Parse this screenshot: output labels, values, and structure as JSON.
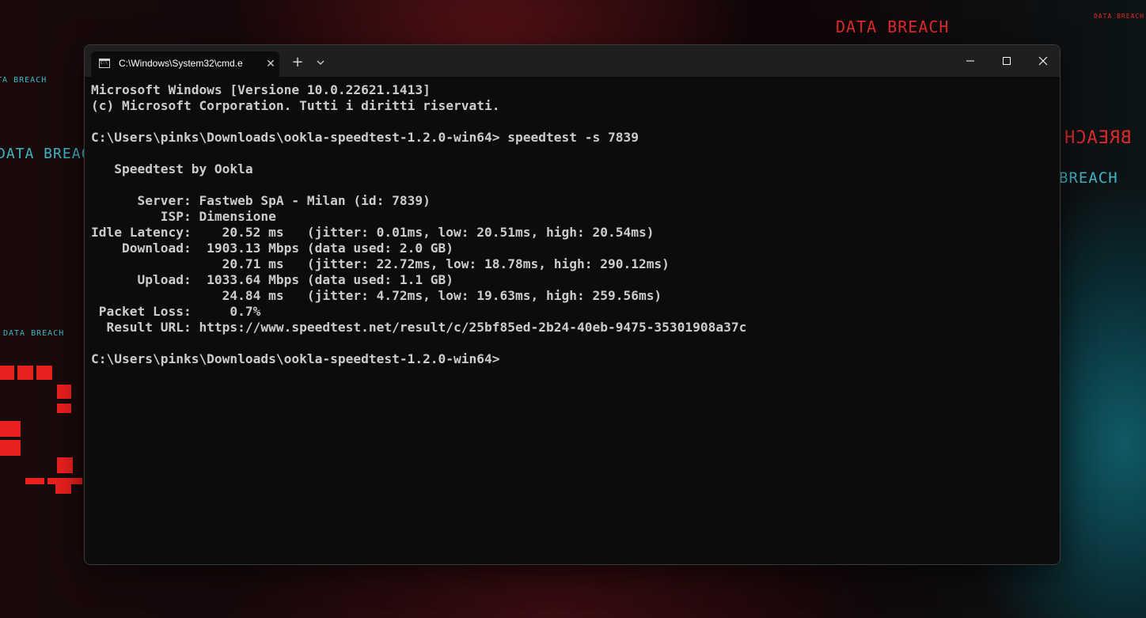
{
  "wallpaper": {
    "texts": [
      {
        "text": "DATA BREACH",
        "color": "#e02a2a"
      },
      {
        "text": "DATA BREACH",
        "color": "#e02a2a"
      },
      {
        "text": "DATA BREACH",
        "color": "#3fb6c4"
      },
      {
        "text": "DATA BREACH",
        "color": "#3fb6c4"
      },
      {
        "text": "DATA BREACH",
        "color": "#3fb6c4"
      },
      {
        "text": "BREACH",
        "color": "#e02a2a"
      },
      {
        "text": "BREACH",
        "color": "#3fb6c4"
      }
    ]
  },
  "window": {
    "tab_title": "C:\\Windows\\System32\\cmd.e",
    "tab_icon": "cmd-icon",
    "tab_close_glyph": "✕",
    "new_tab_glyph": "+",
    "dropdown_icon": "chevron-down-icon",
    "controls": [
      "minimize-icon",
      "maximize-icon",
      "close-icon"
    ]
  },
  "console": {
    "lines": [
      "Microsoft Windows [Versione 10.0.22621.1413]",
      "(c) Microsoft Corporation. Tutti i diritti riservati.",
      "",
      "C:\\Users\\pinks\\Downloads\\ookla-speedtest-1.2.0-win64> speedtest -s 7839",
      "",
      "   Speedtest by Ookla",
      "",
      "      Server: Fastweb SpA - Milan (id: 7839)",
      "         ISP: Dimensione",
      "Idle Latency:    20.52 ms   (jitter: 0.01ms, low: 20.51ms, high: 20.54ms)",
      "    Download:  1903.13 Mbps (data used: 2.0 GB)",
      "                 20.71 ms   (jitter: 22.72ms, low: 18.78ms, high: 290.12ms)",
      "      Upload:  1033.64 Mbps (data used: 1.1 GB)",
      "                 24.84 ms   (jitter: 4.72ms, low: 19.63ms, high: 259.56ms)",
      " Packet Loss:     0.7%",
      "  Result URL: https://www.speedtest.net/result/c/25bf85ed-2b24-40eb-9475-35301908a37c",
      "",
      "C:\\Users\\pinks\\Downloads\\ookla-speedtest-1.2.0-win64>"
    ]
  },
  "colors": {
    "console_bg": "#0c0c0c",
    "console_text": "#cccccc",
    "titlebar_bg": "#1f1f1f"
  }
}
